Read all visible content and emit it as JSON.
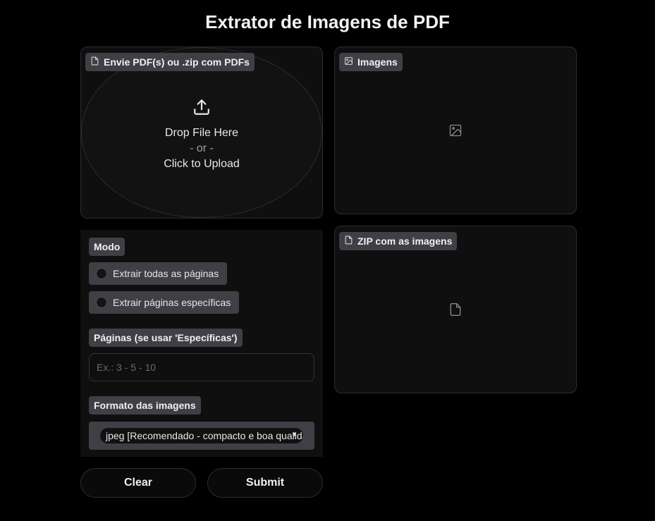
{
  "page": {
    "title": "Extrator de Imagens de PDF"
  },
  "upload": {
    "label": "Envie PDF(s) ou .zip com PDFs",
    "drop_text": "Drop File Here",
    "or_text": "- or -",
    "click_text": "Click to Upload"
  },
  "images": {
    "label": "Imagens"
  },
  "zip": {
    "label": "ZIP com as imagens"
  },
  "form": {
    "mode_label": "Modo",
    "mode_options": [
      "Extrair todas as páginas",
      "Extrair páginas específicas"
    ],
    "pages_label": "Páginas (se usar 'Específicas')",
    "pages_placeholder": "Ex.: 3 - 5 - 10",
    "pages_value": "",
    "format_label": "Formato das imagens",
    "format_selected": "jpeg [Recomendado - compacto e boa qualidade]"
  },
  "buttons": {
    "clear": "Clear",
    "submit": "Submit"
  },
  "icons": {
    "upload": "file-icon",
    "images": "image-icon",
    "zip": "file-icon",
    "upload_action": "upload-arrow-icon"
  },
  "colors": {
    "background": "#000000",
    "panel": "#0f0f0f",
    "tag": "#3f3f46",
    "border": "#2c2c2e"
  }
}
